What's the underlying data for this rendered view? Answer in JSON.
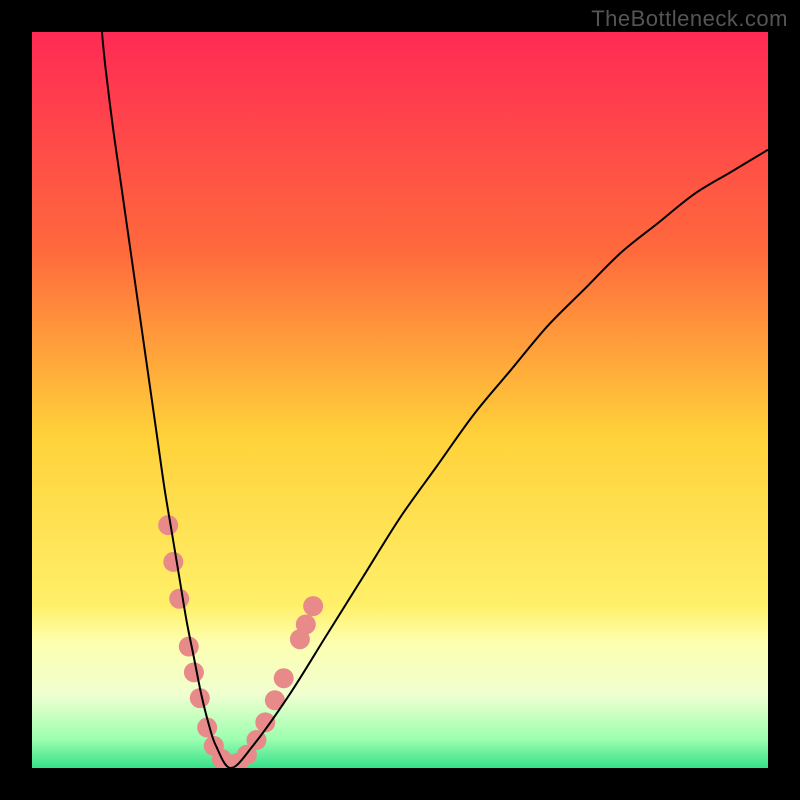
{
  "watermark": "TheBottleneck.com",
  "chart_data": {
    "type": "line",
    "title": "",
    "xlabel": "",
    "ylabel": "",
    "xlim": [
      0,
      100
    ],
    "ylim": [
      0,
      100
    ],
    "grid": false,
    "legend": false,
    "background_gradient": {
      "stops": [
        {
          "pos": 0.0,
          "color": "#ff2a55"
        },
        {
          "pos": 0.3,
          "color": "#ff6a3c"
        },
        {
          "pos": 0.55,
          "color": "#ffd23a"
        },
        {
          "pos": 0.78,
          "color": "#fff06a"
        },
        {
          "pos": 0.83,
          "color": "#fdffb0"
        },
        {
          "pos": 0.9,
          "color": "#f0ffd0"
        },
        {
          "pos": 0.96,
          "color": "#9dffb0"
        },
        {
          "pos": 1.0,
          "color": "#37e08a"
        }
      ]
    },
    "series": [
      {
        "name": "bottleneck-curve",
        "color": "#000000",
        "x": [
          9.5,
          10,
          11,
          12,
          13,
          14,
          15,
          16,
          17,
          18,
          19,
          20,
          21,
          22,
          23,
          24,
          25,
          27,
          30,
          35,
          40,
          45,
          50,
          55,
          60,
          65,
          70,
          75,
          80,
          85,
          90,
          95,
          100
        ],
        "y": [
          100,
          95,
          87,
          80,
          73,
          66,
          59,
          52,
          45,
          38,
          32,
          26,
          20,
          15,
          10,
          6,
          3,
          0,
          3,
          10,
          18,
          26,
          34,
          41,
          48,
          54,
          60,
          65,
          70,
          74,
          78,
          81,
          84
        ]
      }
    ],
    "points": {
      "name": "highlighted-markers",
      "color": "#e88a8a",
      "radius_px": 10,
      "xy": [
        [
          18.5,
          33
        ],
        [
          19.2,
          28
        ],
        [
          20.0,
          23
        ],
        [
          21.3,
          16.5
        ],
        [
          22.0,
          13
        ],
        [
          22.8,
          9.5
        ],
        [
          23.8,
          5.5
        ],
        [
          24.7,
          3
        ],
        [
          25.8,
          1.2
        ],
        [
          27.0,
          0.5
        ],
        [
          28.0,
          0.7
        ],
        [
          29.2,
          1.8
        ],
        [
          30.5,
          3.8
        ],
        [
          31.7,
          6.2
        ],
        [
          33.0,
          9.2
        ],
        [
          34.2,
          12.2
        ],
        [
          36.4,
          17.5
        ],
        [
          37.2,
          19.5
        ],
        [
          38.2,
          22.0
        ]
      ]
    }
  }
}
